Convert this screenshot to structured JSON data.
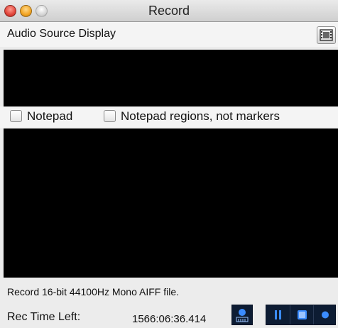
{
  "window": {
    "title": "Record"
  },
  "source": {
    "label": "Audio Source Display",
    "film_icon": "film-strip-icon"
  },
  "options": {
    "notepad_label": "Notepad",
    "notepad_checked": false,
    "regions_label": "Notepad regions, not markers",
    "regions_checked": false
  },
  "status": {
    "text": "Record 16-bit 44100Hz Mono AIFF file."
  },
  "rec_time": {
    "label": "Rec Time Left:",
    "value": "1566:06:36.414"
  },
  "controls": {
    "meter_icon": "input-level-meter-icon",
    "pause_icon": "pause-icon",
    "stop_icon": "stop-icon",
    "record_icon": "record-icon",
    "accent": "#3b8cff",
    "button_bg": "#0d1c33"
  }
}
